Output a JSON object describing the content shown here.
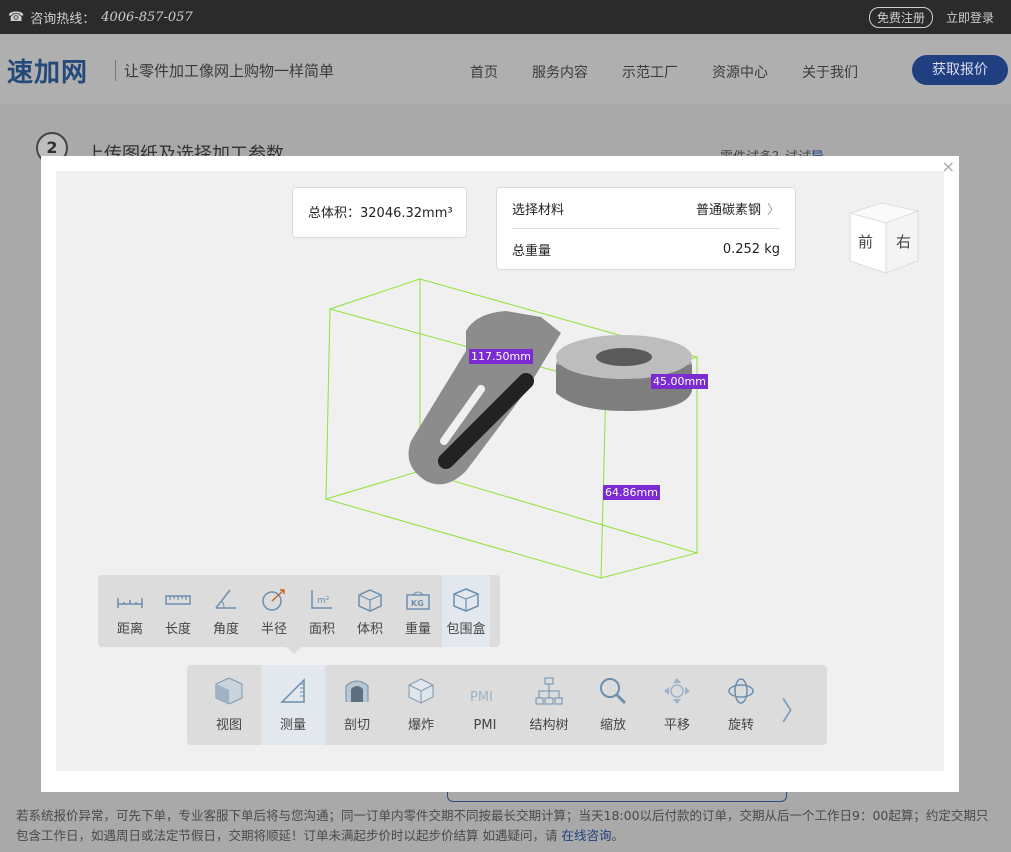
{
  "topbar": {
    "hotline_label": "咨询热线：",
    "phone": "4006-857-057",
    "register": "免费注册",
    "login": "立即登录"
  },
  "header": {
    "logo": "速加网",
    "slogan": "让零件加工像网上购物一样简单",
    "nav": [
      "首页",
      "服务内容",
      "示范工厂",
      "资源中心",
      "关于我们"
    ],
    "quote_button": "获取报价"
  },
  "page": {
    "step_number": "2",
    "step_title": "上传图纸及选择加工参数",
    "note_text": "零件试多？试试",
    "note_link": "导...",
    "footer_text": "若系统报价异常，可先下单，专业客服下单后将与您沟通；同一订单内零件交期不同按最长交期计算；当天18:00以后付款的订单，交期从后一个工作日9：00起算；约定交期只包含工作日，如遇周日或法定节假日，交期将顺延！订单未满起步价时以起步价结算 如遇疑问，请",
    "footer_link": "在线咨询",
    "footer_end": "。"
  },
  "modal": {
    "close": "×",
    "volume_label": "总体积：",
    "volume_value": "32046.32mm³",
    "material_label": "选择材料",
    "material_value": "普通碳素钢",
    "weight_label": "总重量",
    "weight_value": "0.252 kg",
    "cube_front": "前",
    "cube_right": "右",
    "dimensions": {
      "length": "117.50mm",
      "height": "45.00mm",
      "depth": "64.86mm"
    },
    "measure_tools": [
      {
        "label": "距离",
        "icon": "distance-icon"
      },
      {
        "label": "长度",
        "icon": "length-icon"
      },
      {
        "label": "角度",
        "icon": "angle-icon"
      },
      {
        "label": "半径",
        "icon": "radius-icon"
      },
      {
        "label": "面积",
        "icon": "area-icon"
      },
      {
        "label": "体积",
        "icon": "volume-icon"
      },
      {
        "label": "重量",
        "icon": "weight-icon"
      },
      {
        "label": "包围盒",
        "icon": "bounding-box-icon"
      }
    ],
    "main_tools": [
      {
        "label": "视图",
        "icon": "view-icon"
      },
      {
        "label": "测量",
        "icon": "measure-icon"
      },
      {
        "label": "剖切",
        "icon": "section-icon"
      },
      {
        "label": "爆炸",
        "icon": "explode-icon"
      },
      {
        "label": "PMI",
        "icon": "pmi-icon"
      },
      {
        "label": "结构树",
        "icon": "structure-tree-icon"
      },
      {
        "label": "缩放",
        "icon": "zoom-icon"
      },
      {
        "label": "平移",
        "icon": "pan-icon"
      },
      {
        "label": "旋转",
        "icon": "rotate-icon"
      }
    ],
    "weight_icon_text": "KG",
    "pmi_icon_text": "PMI",
    "area_icon_text": "m²"
  },
  "colors": {
    "accent": "#1f3f80",
    "dimension_label": "#7a2bd1",
    "bbox": "#8fe23a"
  }
}
